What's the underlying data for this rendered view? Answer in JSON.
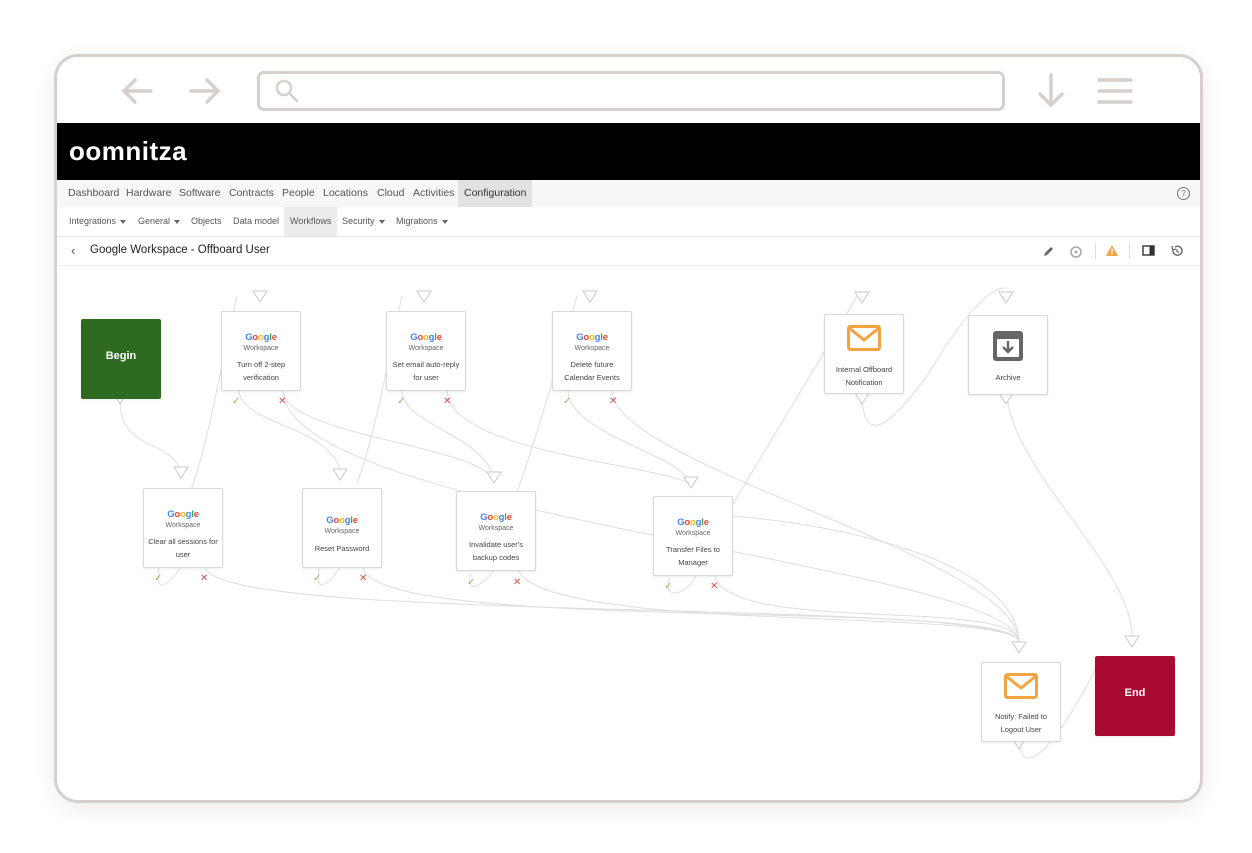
{
  "app": {
    "logo": "oomnitza"
  },
  "main_nav": {
    "items": [
      "Dashboard",
      "Hardware",
      "Software",
      "Contracts",
      "People",
      "Locations",
      "Cloud",
      "Activities",
      "Configuration"
    ],
    "active": "Configuration",
    "help_icon": "help-icon"
  },
  "sub_nav": {
    "items": [
      "Integrations",
      "General",
      "Objects",
      "Data model",
      "Workflows",
      "Security",
      "Migrations"
    ],
    "active": "Workflows"
  },
  "workflow": {
    "title": "Google Workspace - Offboard User"
  },
  "toolbar_icons": [
    "pencil-icon",
    "settings-icon",
    "warning-icon",
    "panel-icon",
    "history-icon"
  ],
  "colors": {
    "begin": "#2f6a21",
    "end": "#a80a32",
    "mail": "#f4a340",
    "warning": "#f4a340"
  },
  "google": {
    "brand": "Google",
    "product": "Workspace"
  },
  "nodes": {
    "begin": "Begin",
    "end": "End",
    "turn_off_2step": "Turn off 2-step verification",
    "auto_reply": "Set email auto-reply for user",
    "delete_calendar": "Delete future Calendar Events",
    "internal_notif": "Internal Offboard Notification",
    "archive": "Archive",
    "clear_sessions": "Clear all sessions for user",
    "reset_password": "Reset Password",
    "invalidate_codes": "Invalidate user's backup codes",
    "transfer_files": "Transfer Files to Manager",
    "notify_failed": "Notify: Failed to Logout User"
  }
}
